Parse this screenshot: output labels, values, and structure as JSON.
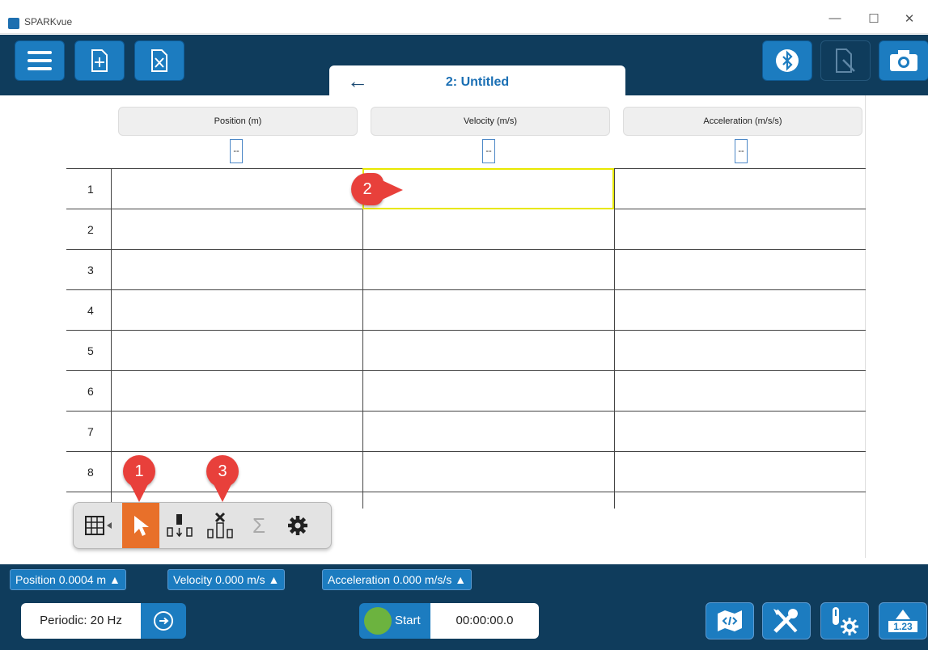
{
  "window": {
    "title": "SPARKvue",
    "minimize": "—",
    "maximize": "☐",
    "close": "✕"
  },
  "toolbar": {
    "buttons": [
      {
        "name": "menu",
        "icon": "menu-icon"
      },
      {
        "name": "new-page",
        "icon": "add-page-icon"
      },
      {
        "name": "delete-page",
        "icon": "delete-page-icon"
      },
      {
        "name": "bluetooth",
        "icon": "bluetooth-icon"
      },
      {
        "name": "annotate",
        "icon": "annotate-icon"
      },
      {
        "name": "snapshot",
        "icon": "camera-icon"
      }
    ],
    "back_arrow": "←",
    "page_tab_title": "2: Untitled"
  },
  "table": {
    "columns": [
      {
        "label": "Position (m)",
        "unit_value": "--"
      },
      {
        "label": "Velocity (m/s)",
        "unit_value": "--"
      },
      {
        "label": "Acceleration (m/s/s)",
        "unit_value": "--"
      }
    ],
    "rows": [
      "1",
      "2",
      "3",
      "4",
      "5",
      "6",
      "7",
      "8"
    ]
  },
  "callouts": {
    "one": "1",
    "two": "2",
    "three": "3"
  },
  "table_tools": {
    "items": [
      "table-icon",
      "select-icon",
      "insert-row-icon",
      "delete-row-icon",
      "statistics-icon",
      "settings-icon"
    ],
    "active": "select-icon",
    "sigma": "Σ"
  },
  "measurements": [
    {
      "label": "Position",
      "value": "0.0004",
      "unit": "m"
    },
    {
      "label": "Velocity",
      "value": "0.000",
      "unit": "m/s"
    },
    {
      "label": "Acceleration",
      "value": "0.000",
      "unit": "m/s/s"
    }
  ],
  "bottom": {
    "sample_rate": "Periodic: 20 Hz",
    "start_label": "Start",
    "timer": "00:00:00.0",
    "calc_label": "1.23"
  },
  "colors": {
    "toolbar_bg": "#0f3c5c",
    "button_blue": "#1c7cc0",
    "active_orange": "#e8702a",
    "callout_red": "#e8403b",
    "start_green": "#6cb33f",
    "selected_cell": "#e8e800"
  }
}
